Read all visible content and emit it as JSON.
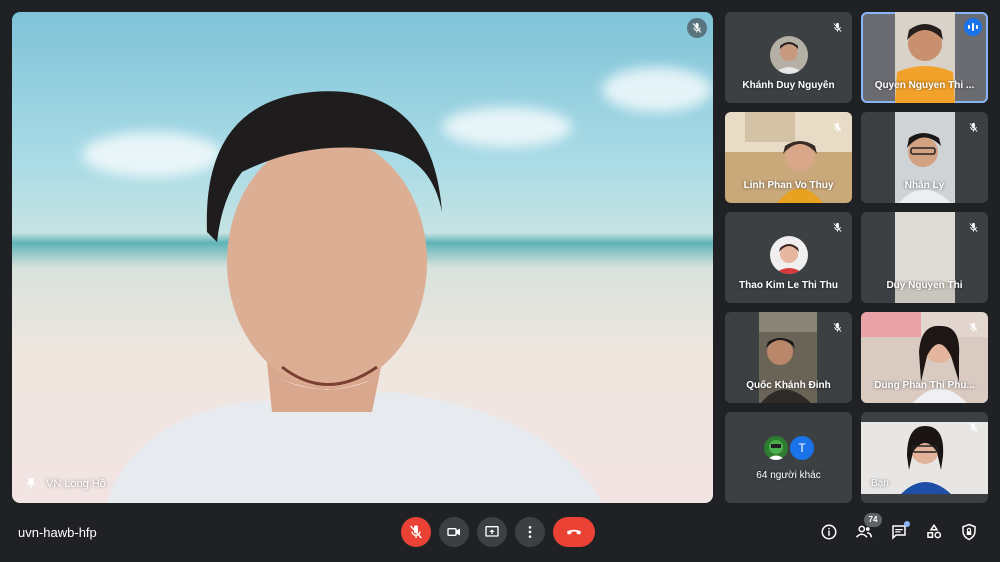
{
  "main": {
    "speaker_name": "VN Long Hồ"
  },
  "participants": [
    {
      "name": "Khánh Duy Nguyễn",
      "muted": true,
      "has_video": false
    },
    {
      "name": "Quyen Nguyen Thi ...",
      "muted": false,
      "speaking": true,
      "has_video": true
    },
    {
      "name": "Linh Phan Vo Thuy",
      "muted": true,
      "has_video": true
    },
    {
      "name": "Nhân Lý",
      "muted": true,
      "has_video": true
    },
    {
      "name": "Thao Kim Le Thi Thu",
      "muted": true,
      "has_video": false
    },
    {
      "name": "Duy Nguyen Thi",
      "muted": true,
      "has_video": true
    },
    {
      "name": "Quốc Khánh Đinh",
      "muted": true,
      "has_video": true
    },
    {
      "name": "Dung Phan Thi Phu...",
      "muted": true,
      "has_video": true
    },
    {
      "name": "Bạn",
      "muted": true,
      "has_video": true
    }
  ],
  "others": {
    "label": "64 người khác",
    "avatar_letter": "T"
  },
  "meeting": {
    "code": "uvn-hawb-hfp"
  },
  "toolbar": {
    "mic": "mic-off-icon",
    "camera": "camera-icon",
    "present": "present-screen-icon",
    "more": "more-vert-icon",
    "leave": "end-call-icon"
  },
  "right_toolbar": {
    "participants_count": "74",
    "info": "info-icon",
    "people": "people-icon",
    "chat": "chat-icon",
    "activities": "activities-icon",
    "safety": "host-controls-icon"
  },
  "colors": {
    "background": "#202124",
    "tile": "#3c4043",
    "leave": "#ea4335",
    "active_outline": "#8ab4f8",
    "speaking": "#1a73e8"
  }
}
